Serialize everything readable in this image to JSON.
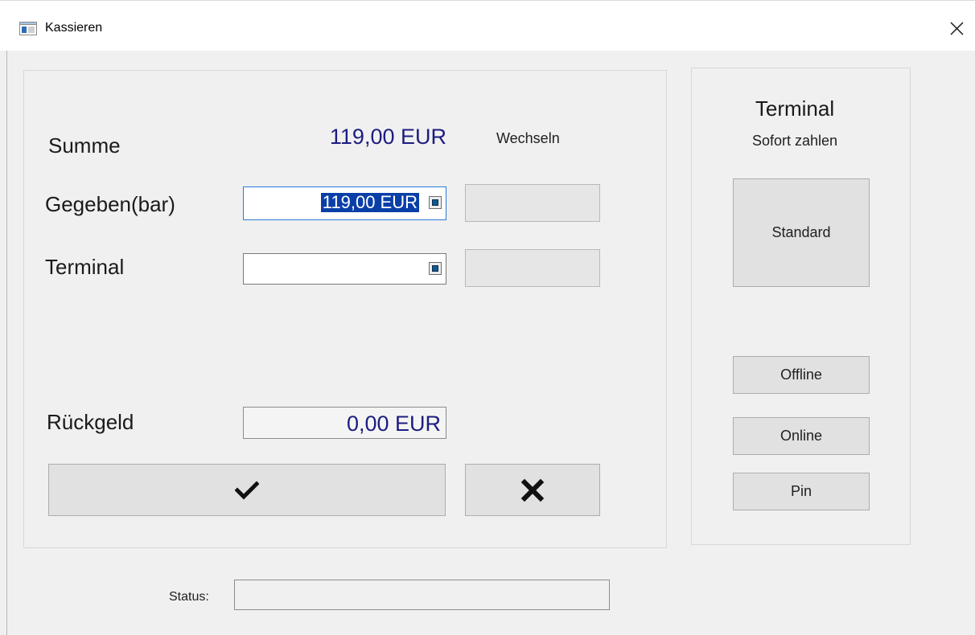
{
  "window": {
    "title": "Kassieren",
    "app_icon": "window-app-icon",
    "close_icon": "close-icon"
  },
  "payment": {
    "summe_label": "Summe",
    "summe_value": "119,00 EUR",
    "wechseln_label": "Wechseln",
    "gegeben_label": "Gegeben(bar)",
    "gegeben_value": "119,00 EUR",
    "terminal_label": "Terminal",
    "terminal_value": "",
    "rueckgeld_label": "Rückgeld",
    "rueckgeld_value": "0,00 EUR",
    "confirm_icon": "checkmark-icon",
    "cancel_icon": "x-icon"
  },
  "terminal_panel": {
    "title": "Terminal",
    "subtitle": "Sofort zahlen",
    "standard_label": "Standard",
    "offline_label": "Offline",
    "online_label": "Online",
    "pin_label": "Pin"
  },
  "status": {
    "label": "Status:",
    "value": ""
  },
  "colors": {
    "amount_text": "#1c1d80",
    "selection_bg": "#0a3fa8",
    "focus_border": "#2a7ad6",
    "window_bg": "#f0f0f0",
    "button_bg": "#e1e1e1"
  }
}
